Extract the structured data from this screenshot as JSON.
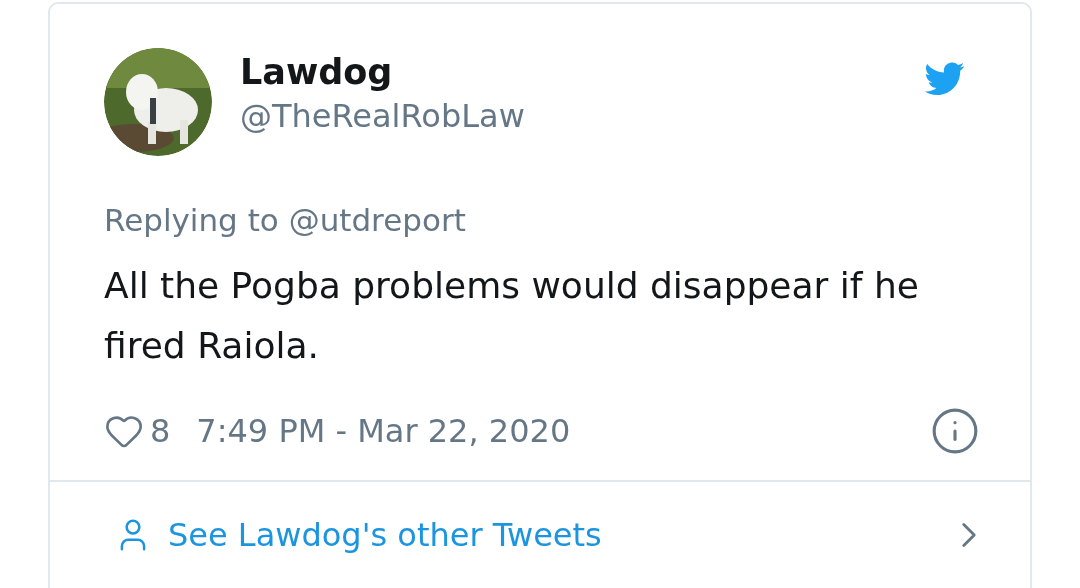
{
  "author": {
    "name": "Lawdog",
    "handle": "@TheRealRobLaw"
  },
  "reply_to": {
    "prefix": "Replying to",
    "handle": "@utdreport"
  },
  "text": "All the Pogba problems would disappear if he fired Raiola.",
  "footer": {
    "likes": "8",
    "timestamp": "7:49 PM - Mar 22, 2020"
  },
  "more_link": "See Lawdog's other Tweets"
}
